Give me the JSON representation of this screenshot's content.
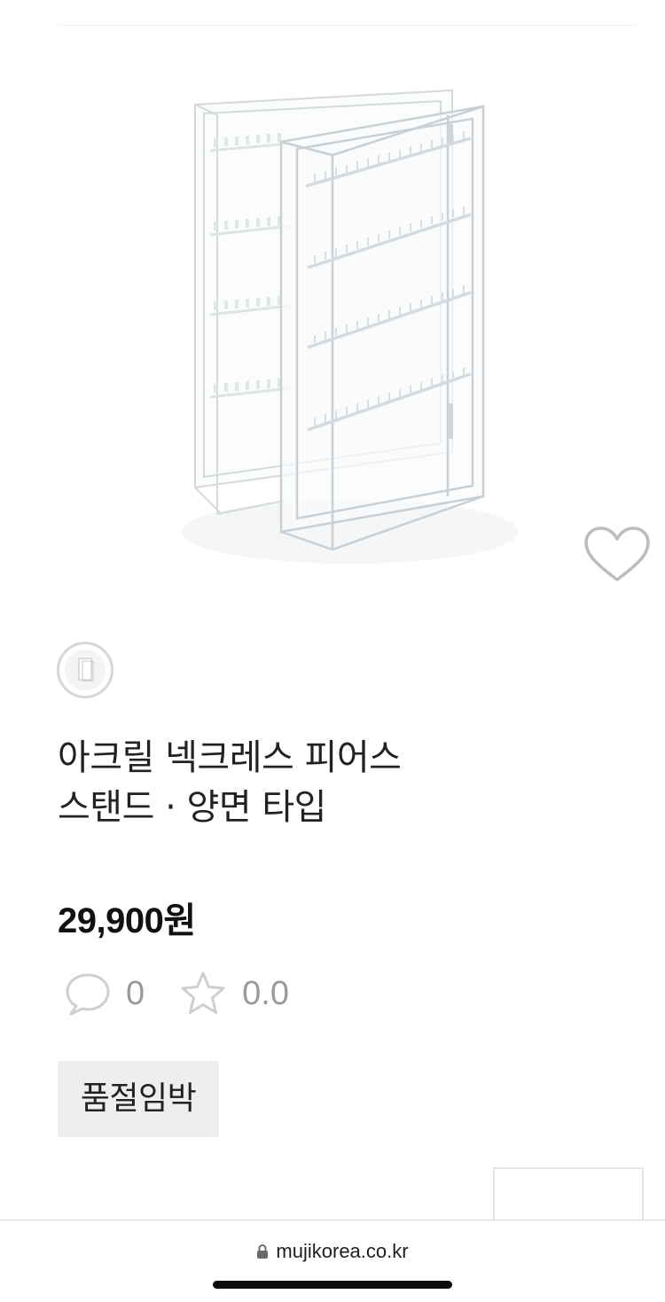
{
  "product": {
    "image_icon": "acrylic-necklace-stand-image",
    "wishlist_icon": "heart-icon",
    "swatch_icon": "color-swatch-thumbnail",
    "title_line1": "아크릴 넥크레스 피어스",
    "title_line2": "스탠드 · 양면 타입",
    "price": "29,900원",
    "review_count": "0",
    "rating": "0.0",
    "badge": "품절임박"
  },
  "browser": {
    "url": "mujikorea.co.kr"
  },
  "colors": {
    "text": "#222222",
    "muted": "#9a9a9a",
    "badge_bg": "#eeeeee"
  }
}
